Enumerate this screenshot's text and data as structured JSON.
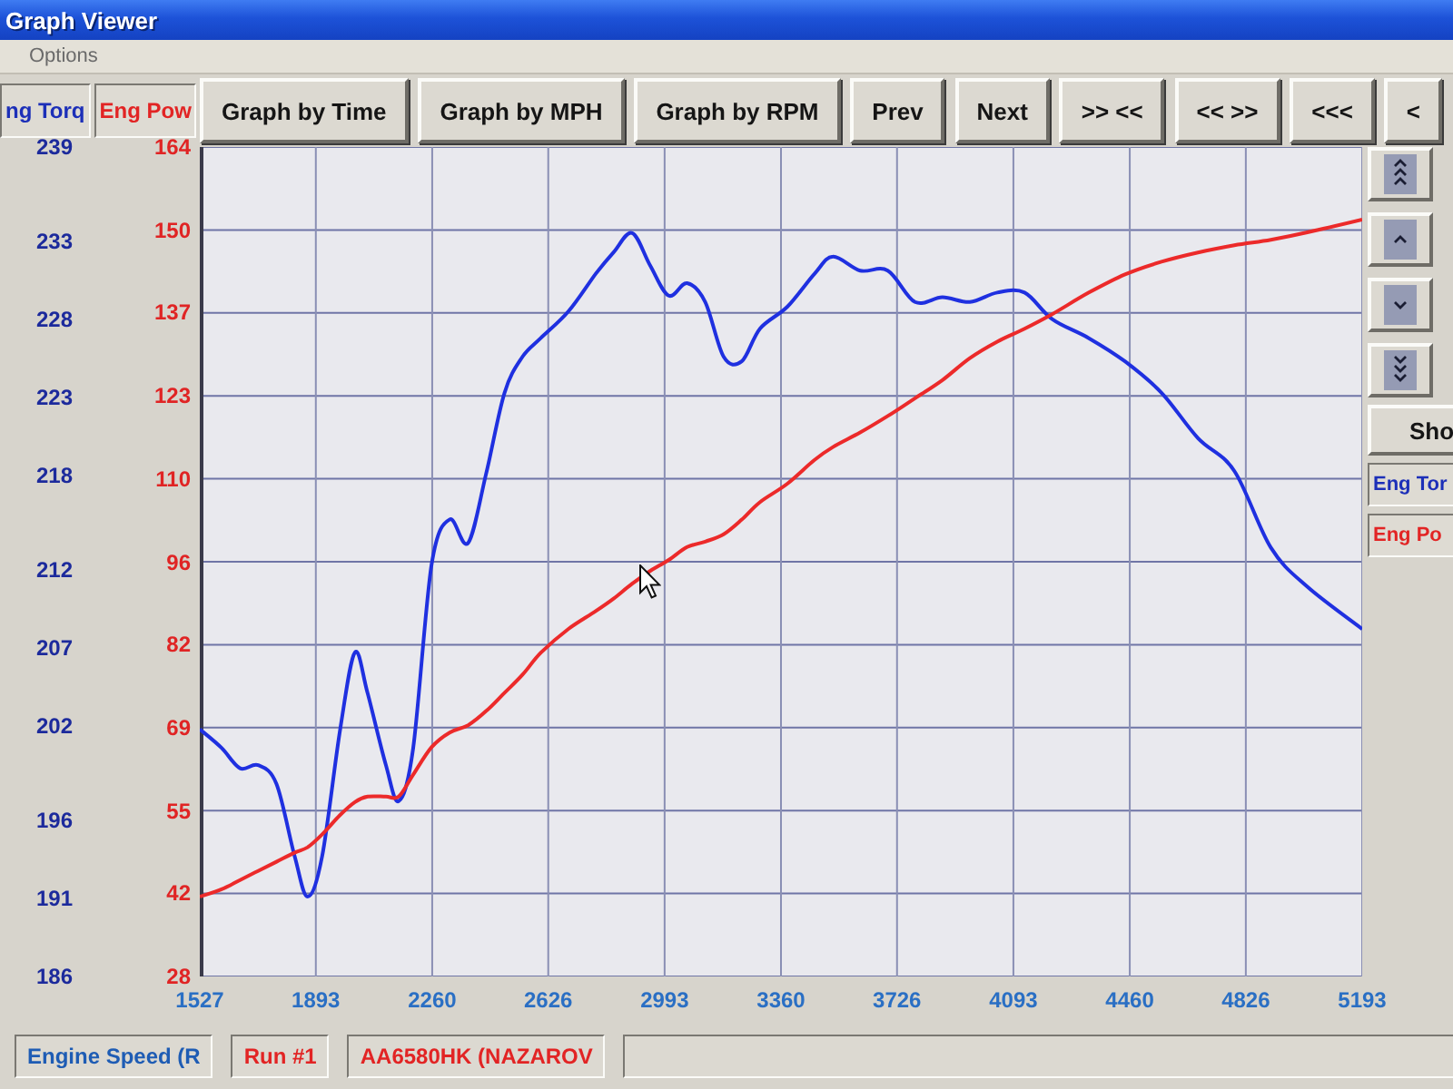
{
  "window": {
    "title": "Graph Viewer"
  },
  "menu": [
    "Options"
  ],
  "legend": [
    {
      "label": "ng Torq",
      "color": "#1c2fb8"
    },
    {
      "label": "Eng Pow",
      "color": "#e22424"
    }
  ],
  "toolbar": [
    "Graph by Time",
    "Graph by MPH",
    "Graph by RPM",
    "Prev",
    "Next",
    ">> <<",
    "<< >>",
    "<<<",
    "<"
  ],
  "chart": {
    "chart_data": {
      "type": "line",
      "grid": true,
      "x": [
        1527,
        1596,
        1654,
        1711,
        1769,
        1826,
        1867,
        1913,
        1970,
        2016,
        2056,
        2114,
        2154,
        2200,
        2258,
        2315,
        2373,
        2430,
        2488,
        2545,
        2603,
        2690,
        2776,
        2833,
        2891,
        2948,
        3006,
        3064,
        3121,
        3179,
        3236,
        3294,
        3380,
        3466,
        3524,
        3610,
        3697,
        3783,
        3869,
        3956,
        4042,
        4128,
        4215,
        4330,
        4445,
        4560,
        4675,
        4790,
        4905,
        5020,
        5193
      ],
      "xlim": [
        1527,
        5193
      ],
      "xticks": [
        1527,
        1893,
        2260,
        2626,
        2993,
        3360,
        3726,
        4093,
        4460,
        4826,
        5193
      ],
      "ylim": [
        186,
        239
      ],
      "yticks": [
        186,
        191,
        196,
        202,
        207,
        212,
        218,
        223,
        228,
        233,
        239
      ],
      "y2lim": [
        28,
        164
      ],
      "y2ticks": [
        {
          "value": 28,
          "label": "28"
        },
        {
          "value": 41.6,
          "label": "42"
        },
        {
          "value": 55.2,
          "label": "55"
        },
        {
          "value": 68.8,
          "label": "69"
        },
        {
          "value": 82.4,
          "label": "82"
        },
        {
          "value": 96,
          "label": "96"
        },
        {
          "value": 109.6,
          "label": "110"
        },
        {
          "value": 123.2,
          "label": "123"
        },
        {
          "value": 136.8,
          "label": "137"
        },
        {
          "value": 150.4,
          "label": "150"
        },
        {
          "value": 164,
          "label": "164"
        }
      ],
      "series": [
        {
          "color": "#1f30e0",
          "axis": "y",
          "values": [
            201.8,
            200.6,
            199.3,
            199.5,
            198.3,
            193.7,
            191.1,
            193.7,
            201.8,
            206.7,
            204.1,
            199.5,
            197.2,
            200.6,
            212.3,
            215.2,
            213.7,
            218.1,
            223.3,
            225.6,
            226.8,
            228.5,
            230.9,
            232.3,
            233.5,
            231.4,
            229.5,
            230.3,
            229.1,
            225.6,
            225.3,
            227.4,
            228.8,
            230.9,
            232.0,
            231.1,
            231.1,
            229.1,
            229.4,
            229.1,
            229.7,
            229.7,
            228.0,
            226.8,
            225.3,
            223.3,
            220.4,
            218.3,
            213.4,
            210.9,
            208.2
          ]
        },
        {
          "color": "#ec2a2a",
          "axis": "y2",
          "values": [
            41.1,
            42.3,
            43.8,
            45.3,
            46.8,
            48.3,
            49.2,
            51.3,
            54.5,
            56.6,
            57.5,
            57.5,
            57.5,
            61.1,
            65.6,
            68.0,
            69.2,
            71.5,
            74.5,
            77.5,
            81.1,
            85.0,
            87.9,
            90.0,
            92.4,
            94.5,
            96.3,
            98.4,
            99.3,
            100.5,
            102.9,
            105.8,
            108.8,
            112.7,
            114.8,
            117.2,
            119.9,
            122.8,
            125.8,
            129.4,
            132.1,
            134.2,
            136.6,
            140.1,
            143.1,
            145.2,
            146.7,
            147.9,
            148.8,
            150.0,
            152.1
          ]
        }
      ]
    }
  },
  "side_panel": {
    "button": "Sho",
    "legend": [
      {
        "label": "Eng Tor",
        "color": "#1c2fb8"
      },
      {
        "label": "Eng Po",
        "color": "#e22424"
      }
    ]
  },
  "status_bar": [
    {
      "text": "Engine Speed (R",
      "color": "#1e5cb4"
    },
    {
      "text": "Run #1",
      "color": "#e22424"
    },
    {
      "text": "AA6580HK (NAZAROV",
      "color": "#e22424"
    }
  ]
}
